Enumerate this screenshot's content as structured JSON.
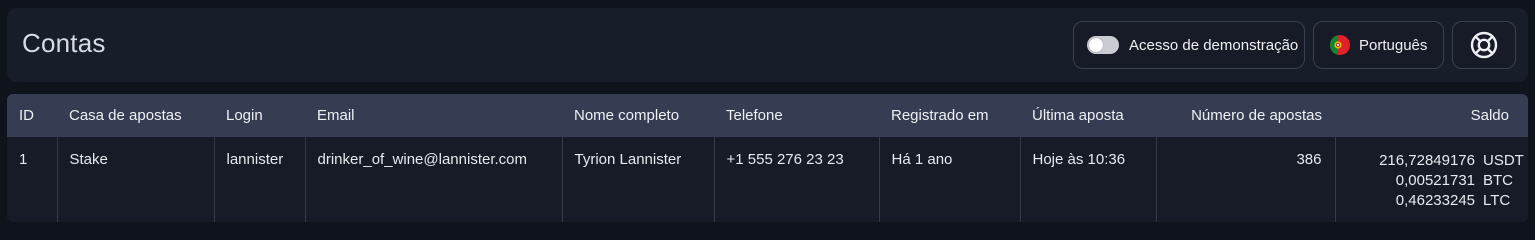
{
  "header": {
    "title": "Contas",
    "demo_label": "Acesso de demonstração",
    "demo_enabled": false,
    "language_label": "Português"
  },
  "table": {
    "columns": [
      "ID",
      "Casa de apostas",
      "Login",
      "Email",
      "Nome completo",
      "Telefone",
      "Registrado em",
      "Última aposta",
      "Número de apostas",
      "Saldo"
    ],
    "rows": [
      {
        "id": "1",
        "bookmaker": "Stake",
        "login": "lannister",
        "email": "drinker_of_wine@lannister.com",
        "full_name": "Tyrion Lannister",
        "phone": "+1 555 276 23 23",
        "registered": "Há 1 ano",
        "last_bet": "Hoje às 10:36",
        "bets_count": "386",
        "balances": [
          {
            "amount": "216,72849176",
            "currency": "USDT"
          },
          {
            "amount": "0,00521731",
            "currency": "BTC"
          },
          {
            "amount": "0,46233245",
            "currency": "LTC"
          }
        ]
      }
    ]
  },
  "colors": {
    "background": "#0f131c",
    "panel": "#181d2a",
    "table_header": "#363d52",
    "table_row": "#161b27"
  },
  "icons": {
    "language": "portugal-flag-icon",
    "help": "lifebuoy-icon"
  }
}
